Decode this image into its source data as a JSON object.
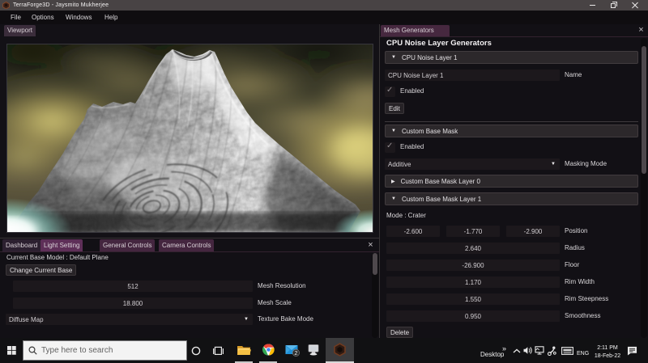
{
  "window": {
    "title": "TerraForge3D - Jaysmito Mukherjee"
  },
  "icons": {
    "close": "×",
    "arrow_down": "▼",
    "arrow_right": "▶",
    "check": "✓",
    "chevrons_expand": "»"
  },
  "menu": {
    "items": [
      "File",
      "Options",
      "Windows",
      "Help"
    ]
  },
  "viewport": {
    "tab": "Viewport"
  },
  "right_panel": {
    "tab": "Mesh Generators",
    "heading": "CPU Noise Layer Generators",
    "noise_layer": {
      "header": "CPU Noise Layer 1",
      "name_value": "CPU Noise Layer 1",
      "name_label": "Name",
      "enabled_label": "Enabled",
      "edit_button": "Edit"
    },
    "base_mask": {
      "header": "Custom Base Mask",
      "enabled_label": "Enabled",
      "masking_mode_value": "Additive",
      "masking_mode_label": "Masking Mode",
      "layer0_header": "Custom Base Mask Layer 0",
      "layer1_header": "Custom Base Mask Layer 1",
      "mode_text": "Mode : Crater",
      "position": {
        "label": "Position",
        "x": "-2.600",
        "y": "-1.770",
        "z": "-2.900"
      },
      "params": [
        {
          "value": "2.640",
          "label": "Radius"
        },
        {
          "value": "-26.900",
          "label": "Floor"
        },
        {
          "value": "1.170",
          "label": "Rim Width"
        },
        {
          "value": "1.550",
          "label": "Rim Steepness"
        },
        {
          "value": "0.950",
          "label": "Smoothness"
        }
      ],
      "delete_button": "Delete"
    }
  },
  "bottom_panel": {
    "tabs": [
      "Dashboard",
      "Light Setting",
      "General Controls",
      "Camera Controls"
    ],
    "current_base_text": "Current Base Model : Default Plane",
    "change_base_button": "Change Current Base",
    "mesh_resolution": {
      "value": "512",
      "label": "Mesh Resolution"
    },
    "mesh_scale": {
      "value": "18.800",
      "label": "Mesh Scale"
    },
    "texture_bake": {
      "value": "Diffuse Map",
      "label": "Texture Bake Mode"
    }
  },
  "taskbar": {
    "search_placeholder": "Type here to search",
    "mail_badge": "2",
    "tray": {
      "toolbar_label": "Desktop",
      "language": "ENG",
      "time": "2:11 PM",
      "date": "18-Feb-22"
    }
  },
  "colors": {
    "accent_purple": "#5e2f58",
    "tab_purple": "#44263f",
    "titlebar": "#484344",
    "panel_bg": "#121015",
    "frame_bg": "#1c181c",
    "header_bg": "#2c282b"
  }
}
